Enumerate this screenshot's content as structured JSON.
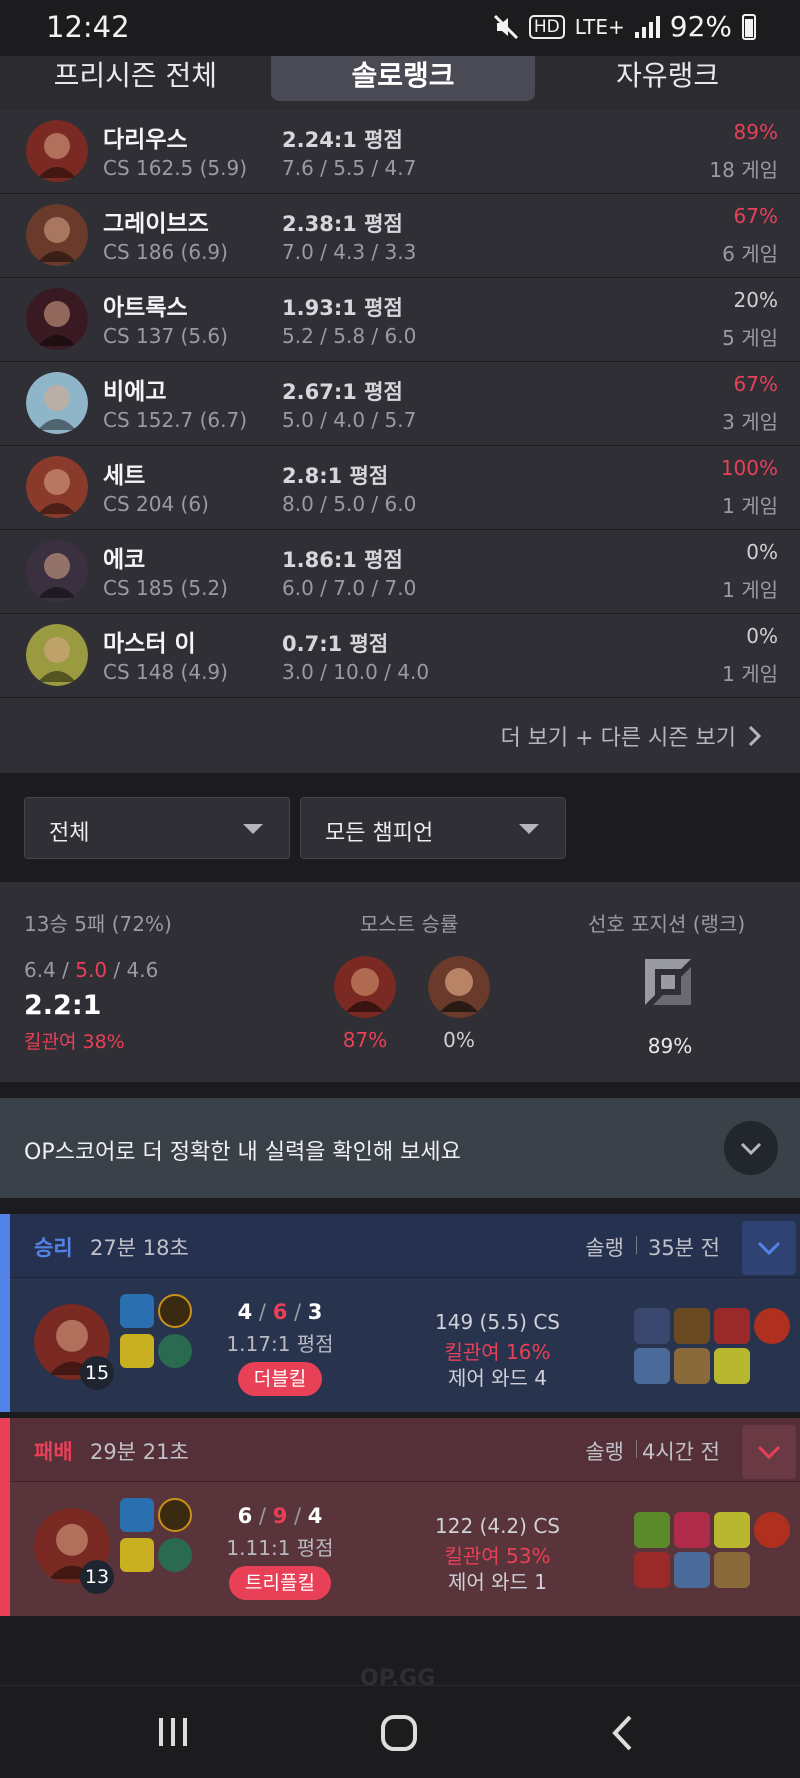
{
  "status_bar": {
    "time": "12:42",
    "network": "LTE+",
    "hd": "HD",
    "battery": "92%"
  },
  "tabs": [
    "프리시즌 전체",
    "솔로랭크",
    "자유랭크"
  ],
  "champions": [
    {
      "name": "다리우스",
      "cs": "CS 162.5 (5.9)",
      "ratio": "2.24:1 평점",
      "kda": "7.6 / 5.5 / 4.7",
      "winrate": "89%",
      "games": "18 게임",
      "color": "#7a2a22"
    },
    {
      "name": "그레이브즈",
      "cs": "CS 186 (6.9)",
      "ratio": "2.38:1 평점",
      "kda": "7.0 / 4.3 / 3.3",
      "winrate": "67%",
      "games": "6 게임",
      "color": "#6a3a2a"
    },
    {
      "name": "아트록스",
      "cs": "CS 137 (5.6)",
      "ratio": "1.93:1 평점",
      "kda": "5.2 / 5.8 / 6.0",
      "winrate": "20%",
      "games": "5 게임",
      "color": "#3a1a22"
    },
    {
      "name": "비에고",
      "cs": "CS 152.7 (6.7)",
      "ratio": "2.67:1 평점",
      "kda": "5.0 / 4.0 / 5.7",
      "winrate": "67%",
      "games": "3 게임",
      "color": "#8fb6c8"
    },
    {
      "name": "세트",
      "cs": "CS 204 (6)",
      "ratio": "2.8:1 평점",
      "kda": "8.0 / 5.0 / 6.0",
      "winrate": "100%",
      "games": "1 게임",
      "color": "#8a3a2a"
    },
    {
      "name": "에코",
      "cs": "CS 185 (5.2)",
      "ratio": "1.86:1 평점",
      "kda": "6.0 / 7.0 / 7.0",
      "winrate": "0%",
      "games": "1 게임",
      "color": "#3a3040"
    },
    {
      "name": "마스터 이",
      "cs": "CS 148 (4.9)",
      "ratio": "0.7:1 평점",
      "kda": "3.0 / 10.0 / 4.0",
      "winrate": "0%",
      "games": "1 게임",
      "color": "#9a9a40"
    }
  ],
  "more_link": "더 보기 + 다른 시즌 보기",
  "filters": {
    "queue": "전체",
    "champion": "모든 챔피언"
  },
  "summary": {
    "record": "13승 5패 (72%)",
    "kda_k": "6.4",
    "kda_d": "5.0",
    "kda_a": "4.6",
    "ratio": "2.2:1",
    "kill_participation": "킬관여 38%",
    "most_winrate_label": "모스트 승률",
    "most": [
      {
        "pct": "87%",
        "color": "#7a2a22"
      },
      {
        "pct": "0%",
        "color": "#6a3a2a"
      }
    ],
    "position_label": "선호 포지션 (랭크)",
    "position_pct": "89%"
  },
  "banner": {
    "text": "OP스코어로 더 정확한 내 실력을 확인해 보세요"
  },
  "matches": [
    {
      "result": "승리",
      "duration": "27분 18초",
      "queue": "솔랭",
      "ago": "35분 전",
      "level": "15",
      "k": "4",
      "d": "6",
      "a": "3",
      "ratio": "1.17:1 평점",
      "badge": "더블킬",
      "cs": "149 (5.5) CS",
      "kp": "킬관여 16%",
      "wards": "제어 와드 4",
      "accent": "#5383e8",
      "bg": "#28344e",
      "header_bg": "#263150"
    },
    {
      "result": "패배",
      "duration": "29분 21초",
      "queue": "솔랭",
      "ago": "4시간 전",
      "level": "13",
      "k": "6",
      "d": "9",
      "a": "4",
      "ratio": "1.11:1 평점",
      "badge": "트리플킬",
      "cs": "122 (4.2) CS",
      "kp": "킬관여 53%",
      "wards": "제어 와드 1",
      "accent": "#e84057",
      "bg": "#59343b",
      "header_bg": "#553039"
    }
  ],
  "footer": "OP.GG"
}
